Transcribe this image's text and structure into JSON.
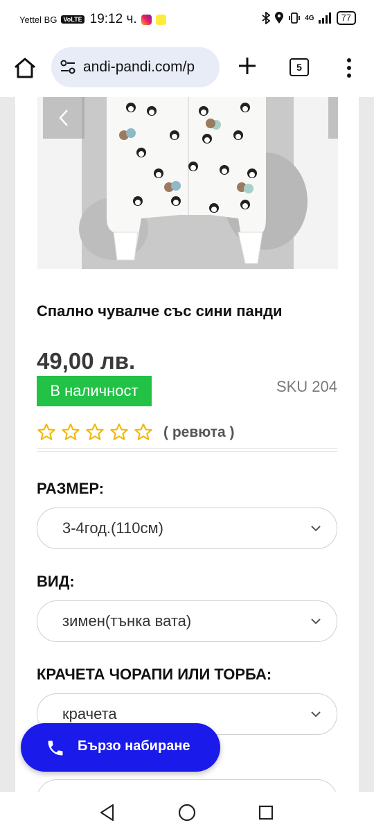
{
  "status_bar": {
    "carrier": "Yettel BG",
    "volte": "VoLTE",
    "time": "19:12 ч.",
    "network": "4G",
    "battery": "77"
  },
  "browser": {
    "url": "andi-pandi.com/p",
    "tab_count": "5"
  },
  "product": {
    "title": "Спално чувалче със сини панди",
    "price": "49,00 лв.",
    "stock": "В наличност",
    "sku": "SKU 204",
    "rating_stars": 0,
    "reviews_label": "( ревюта )"
  },
  "options": [
    {
      "label": "РАЗМЕР:",
      "value": "3-4год.(110см)"
    },
    {
      "label": "ВИД:",
      "value": "зимен(тънка вата)"
    },
    {
      "label": "КРАЧЕТА ЧОРАПИ ИЛИ ТОРБА:",
      "value": "крачета"
    }
  ],
  "fab": {
    "label": "Бързо набиране",
    "icon": "phone-icon"
  },
  "colors": {
    "accent": "#1a1aea",
    "stock_green": "#21c246",
    "star": "#f2b705"
  }
}
